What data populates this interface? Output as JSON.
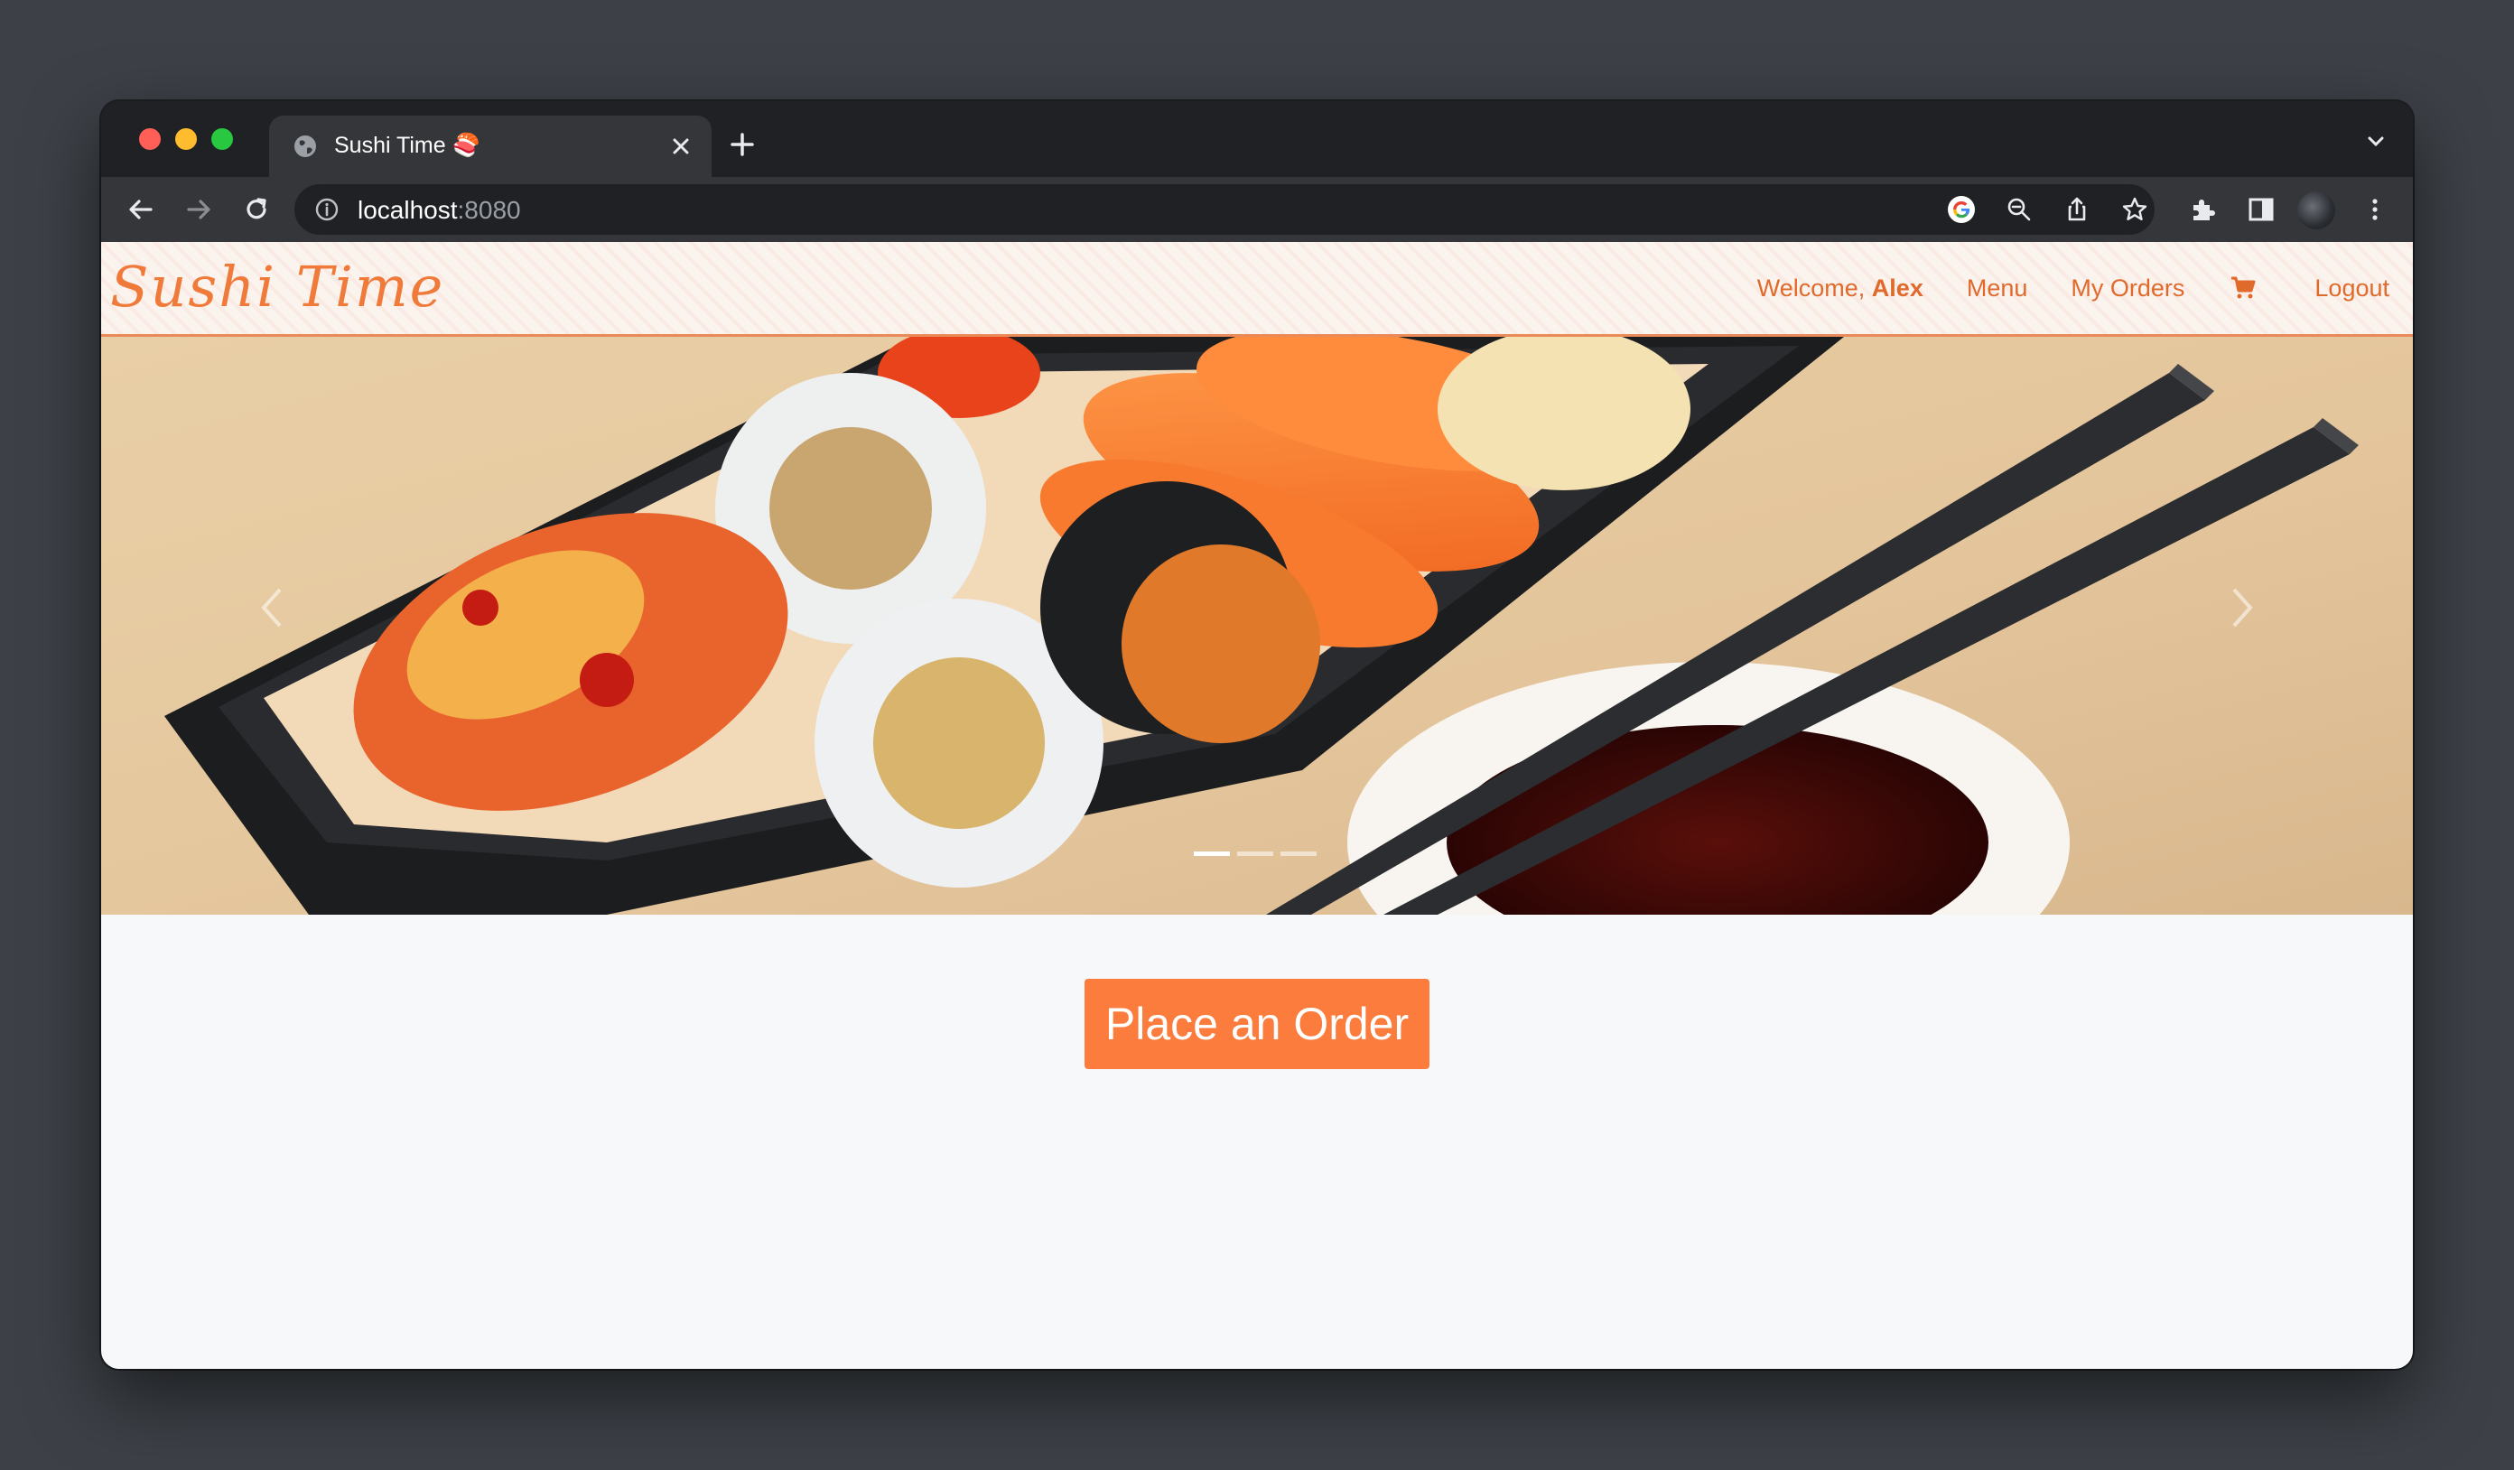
{
  "browser": {
    "tab_title": "Sushi Time 🍣",
    "url_host": "localhost",
    "url_port": ":8080"
  },
  "site": {
    "brand": "Sushi Time",
    "nav": {
      "welcome_prefix": "Welcome, ",
      "user_name": "Alex",
      "menu": "Menu",
      "my_orders": "My Orders",
      "logout": "Logout"
    },
    "carousel": {
      "slide_count": 3,
      "active_index": 0
    },
    "cta_label": "Place an Order"
  },
  "colors": {
    "accent": "#fb7c3c",
    "nav_text": "#e06a2c",
    "navbar_bg": "#fbf3ee",
    "browser_dark": "#202124",
    "browser_toolbar": "#35363a"
  },
  "icons": [
    "globe-icon",
    "close-icon",
    "plus-icon",
    "chevron-down-icon",
    "back-arrow-icon",
    "forward-arrow-icon",
    "reload-icon",
    "info-icon",
    "google-icon",
    "zoom-out-icon",
    "share-icon",
    "star-icon",
    "extensions-icon",
    "sidepanel-icon",
    "kebab-menu-icon",
    "cart-icon",
    "chevron-left-icon",
    "chevron-right-icon"
  ]
}
